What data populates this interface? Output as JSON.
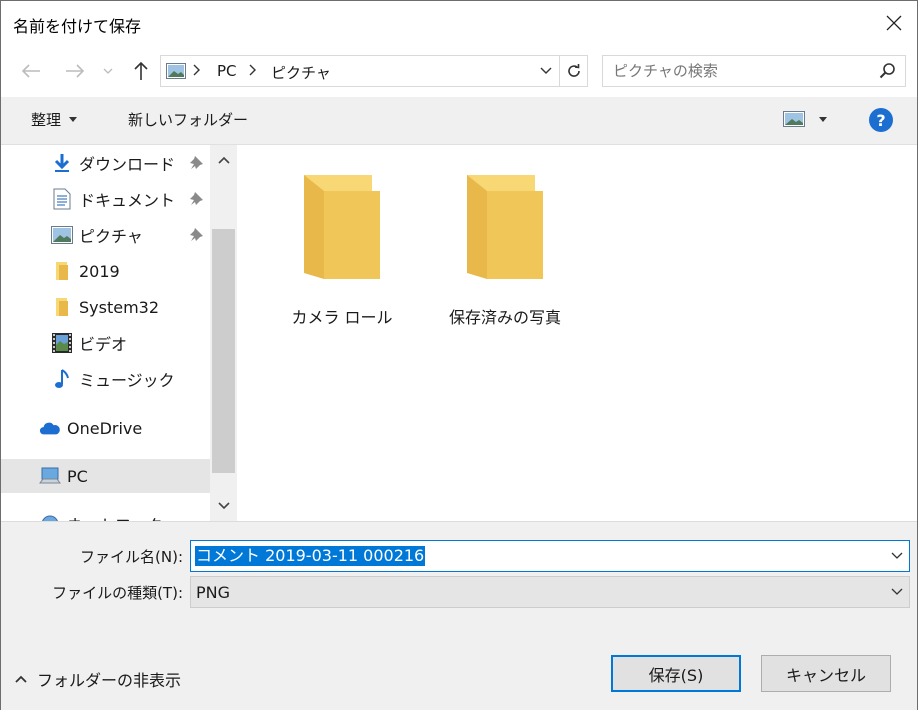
{
  "window": {
    "title": "名前を付けて保存"
  },
  "nav": {
    "path": [
      "PC",
      "ピクチャ"
    ],
    "search_placeholder": "ピクチャの検索"
  },
  "toolbar": {
    "organize": "整理",
    "new_folder": "新しいフォルダー",
    "help": "?"
  },
  "sidebar": {
    "items": [
      {
        "label": "ダウンロード",
        "icon": "download-icon",
        "pinned": true
      },
      {
        "label": "ドキュメント",
        "icon": "document-icon",
        "pinned": true
      },
      {
        "label": "ピクチャ",
        "icon": "pictures-icon",
        "pinned": true
      },
      {
        "label": "2019",
        "icon": "folder-icon",
        "pinned": false
      },
      {
        "label": "System32",
        "icon": "folder-icon",
        "pinned": false
      },
      {
        "label": "ビデオ",
        "icon": "video-icon",
        "pinned": false
      },
      {
        "label": "ミュージック",
        "icon": "music-icon",
        "pinned": false
      },
      {
        "label": "OneDrive",
        "icon": "onedrive-icon",
        "pinned": false
      },
      {
        "label": "PC",
        "icon": "pc-icon",
        "pinned": false,
        "selected": true
      },
      {
        "label": "ネットワーク",
        "icon": "network-icon",
        "pinned": false
      }
    ]
  },
  "folders": [
    {
      "name": "カメラ ロール"
    },
    {
      "name": "保存済みの写真"
    }
  ],
  "form": {
    "filename_label": "ファイル名(N):",
    "filename_value": "コメント 2019-03-11 000216",
    "filetype_label": "ファイルの種類(T):",
    "filetype_value": "PNG",
    "hide_folders": "フォルダーの非表示",
    "save": "保存(S)",
    "cancel": "キャンセル"
  },
  "colors": {
    "accent": "#0078d7",
    "folder": "#f8d775",
    "help": "#1c6fd1"
  }
}
